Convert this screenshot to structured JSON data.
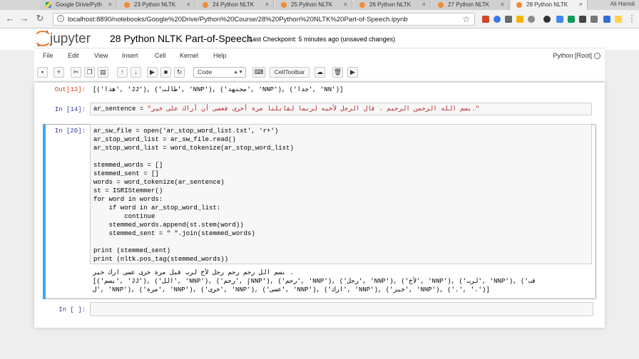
{
  "browser": {
    "tabs": [
      {
        "label": "Google Drive/Pyth",
        "icon": "drive-icon"
      },
      {
        "label": "23 Python NLTK",
        "icon": "jupyter-icon"
      },
      {
        "label": "24 Python NLTK",
        "icon": "jupyter-icon"
      },
      {
        "label": "25 Python NLTK",
        "icon": "jupyter-icon"
      },
      {
        "label": "26 Python NLTK",
        "icon": "jupyter-icon"
      },
      {
        "label": "27 Python NLTK",
        "icon": "jupyter-icon"
      },
      {
        "label": "28 Python NLTK",
        "icon": "jupyter-icon",
        "active": true
      }
    ],
    "user": "Ali Hamdi",
    "url": "localhost:8890/notebooks/Google%20Drive/Python%20Course/28%20Python%20NLTK%20Part-of-Speech.ipynb"
  },
  "jupyter": {
    "logo_text": "jupyter",
    "title": "28 Python NLTK Part-of-Speech",
    "checkpoint": "Last Checkpoint: 5 minutes ago (unsaved changes)",
    "menu": [
      "File",
      "Edit",
      "View",
      "Insert",
      "Cell",
      "Kernel",
      "Help"
    ],
    "kernel": "Python [Root]",
    "toolbar": {
      "cell_type": "Code",
      "celltoolbar": "CellToolbar"
    }
  },
  "cells": {
    "out13": {
      "prompt": "Out[13]:",
      "text": "[('هذا', 'JJ'), ('طالب', 'NNP'), ('مجتهد', 'NNP'), ('جدا', 'NN')]"
    },
    "in14": {
      "prompt": "In [14]:",
      "code_var": "ar_sentence = ",
      "code_str": "\"بسم الله الرحمن الرحيم ، قال الرجل لأخيه لربما لقابلنا مرة أخرى فعسى أن أراك على خير.\""
    },
    "in20": {
      "prompt": "In [20]:",
      "lines": [
        "ar_sw_file = open('ar_stop_word_list.txt', 'r+')",
        "ar_stop_word_list = ar_sw_file.read()",
        "ar_stop_word_list = word_tokenize(ar_stop_word_list)",
        "",
        "stemmed_words = []",
        "stemmed_sent = []",
        "words = word_tokenize(ar_sentence)",
        "st = ISRIStemmer()",
        "for word in words:",
        "    if word in ar_stop_word_list:",
        "        continue",
        "    stemmed_words.append(st.stem(word))",
        "    stemmed_sent = \" \".join(stemmed_words)",
        "",
        "print (stemmed_sent)",
        "print (nltk.pos_tag(stemmed_words))"
      ],
      "output": [
        "بسم الل رحم رحم رجل لأخ لرب قبل مرة خرى عسى ارك خير .",
        "[('بسم', 'JJ'), ('الل', 'NNP'), ('رحم', 'NNP'), ('رحم', 'NNP'), ('رجل', 'NNP'), ('لأخ', 'NNP'), ('لرب', 'NNP'), ('قب",
        "ل', 'NNP'), ('مرة', 'NNP'), ('خرى', 'NNP'), ('عسى', 'NNP'), ('ارك', 'NNP'), ('خير', 'NNP'), ('.', '.')]"
      ]
    },
    "empty": {
      "prompt": "In [ ]:"
    }
  },
  "colors": {
    "in_prompt": "#303f9f",
    "out_prompt": "#d84315",
    "keyword": "#008000",
    "string": "#ba2121",
    "selected_cell_bar": "#42a5f5"
  }
}
